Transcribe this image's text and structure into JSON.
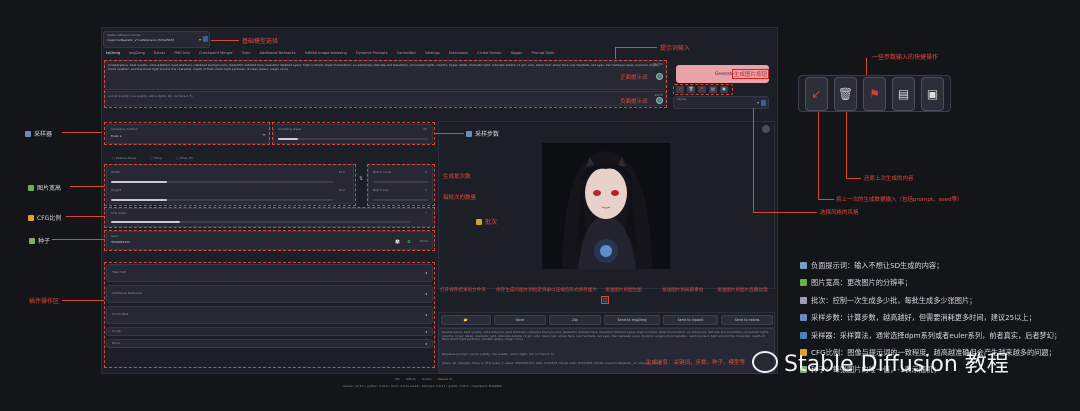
{
  "model": {
    "title": "stable-diffusion-model",
    "value": "majicmixRealistic_v7.safetensors [8c5ef9b5]"
  },
  "tabs": [
    "txt2img",
    "img2img",
    "Extras",
    "PNG Info",
    "Checkpoint Merger",
    "Train",
    "Additional Networks",
    "Infinite image browsing",
    "Dynamic Prompts",
    "ControlNet",
    "Settings",
    "Extensions",
    "Civitai Helper",
    "Tagger",
    "Prompt Tools"
  ],
  "prompt": {
    "positive": "(masterpiece, best quality, ultra-detailed, best shadow), (detailed background), (beautiful detailed face, beautiful detailed eyes), high contrast, (best illumination, an extremely delicate and beautiful), (cinematic light), colorful, hyper detail, dramatic light, intricate details, (1 girl, solo, black hair, sharp face, low twintails, red eyes, hair between eyes, dynamic angle), blood splatter, swirling black light around the character, depth of field, black light particles, (broken glass), magic circle",
    "negative": "(worst quality, low quality, extra digits, loli, loli face:1.3)",
    "positive_count": "75/150",
    "negative_count": "19/75"
  },
  "generate": {
    "label": "Generate",
    "tag": "生成图片按钮"
  },
  "styles_label": "Styles",
  "sampler": {
    "method_label": "Sampling method",
    "method_value": "Euler a",
    "steps_label": "Sampling steps",
    "steps_value": "20",
    "steps_fraction": 0.13
  },
  "extras": [
    "Restore faces",
    "Tiling",
    "Hires. fix"
  ],
  "size": {
    "width_label": "Width",
    "width_value": "512",
    "width_fraction": 0.25,
    "height_label": "Height",
    "height_value": "512",
    "height_fraction": 0.25
  },
  "batch": {
    "count_label": "Batch count",
    "count_value": "1",
    "size_label": "Batch size",
    "size_value": "1"
  },
  "cfg": {
    "label": "CFG Scale",
    "value": "7",
    "fraction": 0.23
  },
  "seed": {
    "label": "Seed",
    "value": "3500059722",
    "extra_label": "Extra"
  },
  "plugins": [
    "Tiled VAE",
    "Additional Networks",
    "ControlNet",
    "Script",
    "None"
  ],
  "output_buttons": [
    "📂",
    "Save",
    "Zip",
    "Send to img2img",
    "Send to inpaint",
    "Send to extras"
  ],
  "output_info": "(masterpiece, best quality, ultra-detailed, best shadow), (detailed background), (beautiful detailed face, beautiful detailed eyes), high contrast, (best illumination, an extremely delicate and beautiful), (cinematic light), colorful, hyper detail, dramatic light, intricate details, (1 girl, solo, black hair, sharp face, low twintails, red eyes, hair between eyes, dynamic angle), blood splatter, swirling black light around the character, depth of field, black light particles, (broken glass), magic circle",
  "output_negative": "Negative prompt: (worst quality, low quality, extra digits, loli, loli face:1.3)",
  "output_params": "Steps: 20, Sampler: Euler a, CFG scale: 7, Seed: 3500059722, Size: 512x512, Model hash: 8c5ef9b5, Model: majicmixRealistic_v7, Version: v1.3.2",
  "footer": {
    "links": [
      "API",
      "Github",
      "Gradio",
      "Reload UI"
    ],
    "version": "version: v1.3.2  •  python: 3.10.6  •  torch: 2.0.0+cu118  •  xformers: 0.0.17  •  gradio: 3.32.0  •  checkpoint: 8c5ef9b5"
  },
  "annotations": {
    "model": "基础模型选择",
    "prompt_input": "提示词输入",
    "positive": "正面提示词",
    "negative": "负面提示词",
    "quick_ops": "一些参数输入的快捷操作",
    "sampler": "采样器",
    "steps": "采样步数",
    "size": "图片宽高",
    "cfg": "CFG比例",
    "seed": "种子",
    "plugins": "插件操作区",
    "batch_count": "生成批次数",
    "batch_size": "每批次的数量",
    "batch_mark": "批次",
    "restore": "还原上次生成的内容",
    "paste": "将上一次的生成数据输入（包括prompt、seed等）",
    "style": "选择风格的风格",
    "open_folder": "打开保存结果的文件夹",
    "save": "保存生成的图片到指定目录",
    "zip": "以压缩包形式保存图片",
    "send_img2img": "发送图片到图生图",
    "send_inpaint": "发送图片到局部重绘",
    "send_extras": "发送图片到图片后期处理",
    "gen_info": "生成信息：关键词，步数，种子，模型等",
    "gen_image": "生成图片",
    "generate_btn": "生成图片按钮"
  },
  "notes": [
    "负面提示词：输入不想让SD生成的内容；",
    "图片宽高：更改图片的分辨率；",
    "批次：控制一次生成多少批，每批生成多少张图片；",
    "采样步数：计算步数，越高越好，但需要消耗更多时间，建议25以上；",
    "采样器：采样算法，通常选择dpm系列或者euler系列，前者真实，后者梦幻；",
    "CFG比例：图像与提示词的一致程度，越高越准确但会产生越来越多的问题；",
    "种子：每张图片的唯一值，-1表示随机；"
  ],
  "watermark": "Stable Diffusion 教程",
  "colors": {
    "accent": "#e34a3c",
    "generate_bg": "#e9a3a8",
    "background": "#141518"
  }
}
